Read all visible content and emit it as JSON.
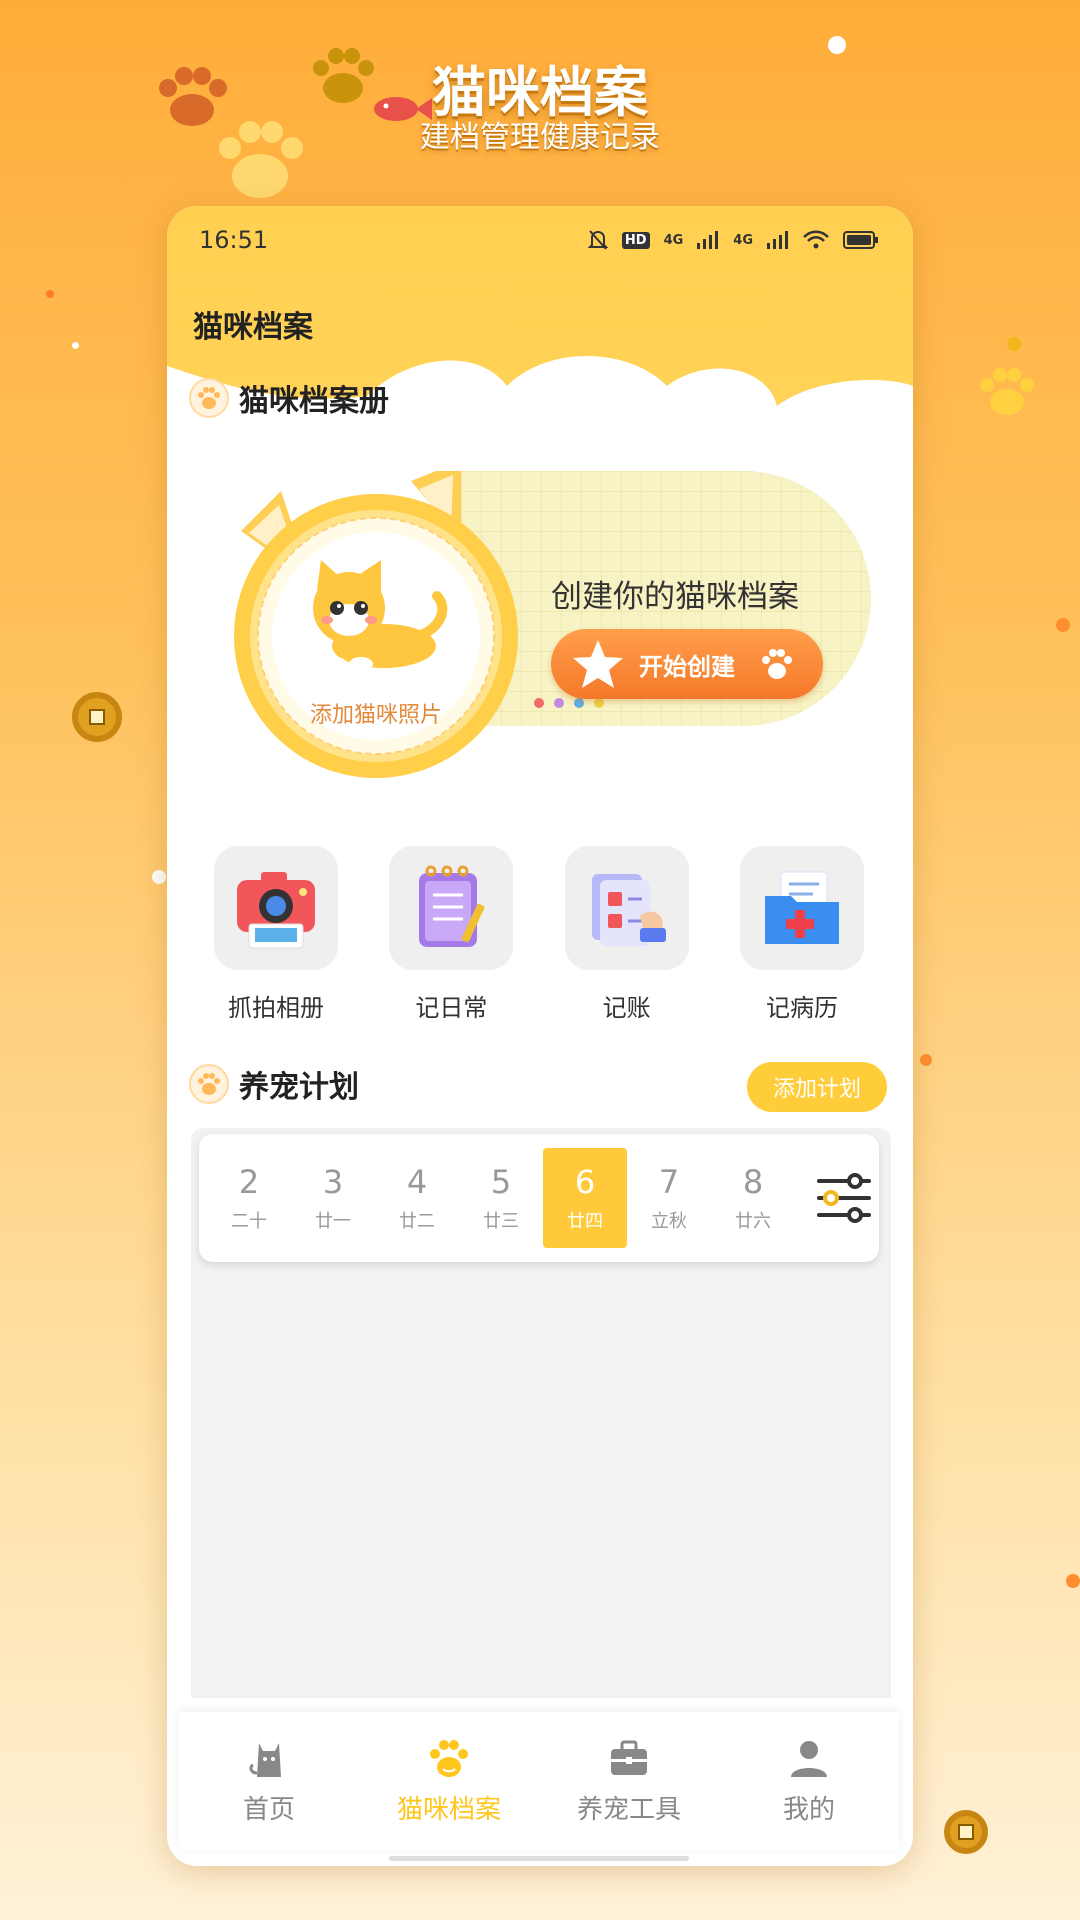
{
  "promo": {
    "title": "猫咪档案",
    "subtitle": "建档管理健康记录"
  },
  "statusbar": {
    "time": "16:51",
    "network_1": "4G",
    "network_2": "4G",
    "hd_label": "HD"
  },
  "app": {
    "title": "猫咪档案"
  },
  "archive": {
    "section_title": "猫咪档案册",
    "avatar_label": "添加猫咪照片",
    "create_text": "创建你的猫咪档案",
    "start_button": "开始创建"
  },
  "tools": [
    {
      "label": "抓拍相册",
      "icon": "camera-icon"
    },
    {
      "label": "记日常",
      "icon": "notebook-icon"
    },
    {
      "label": "记账",
      "icon": "ledger-icon"
    },
    {
      "label": "记病历",
      "icon": "medical-folder-icon"
    }
  ],
  "plan": {
    "section_title": "养宠计划",
    "add_button": "添加计划",
    "dates": [
      {
        "num": "2",
        "lunar": "二十"
      },
      {
        "num": "3",
        "lunar": "廿一"
      },
      {
        "num": "4",
        "lunar": "廿二"
      },
      {
        "num": "5",
        "lunar": "廿三"
      },
      {
        "num": "6",
        "lunar": "廿四"
      },
      {
        "num": "7",
        "lunar": "立秋"
      },
      {
        "num": "8",
        "lunar": "廿六"
      }
    ],
    "selected_index": 4
  },
  "nav": [
    {
      "label": "首页",
      "icon": "cat-icon"
    },
    {
      "label": "猫咪档案",
      "icon": "paw-icon"
    },
    {
      "label": "养宠工具",
      "icon": "toolbox-icon"
    },
    {
      "label": "我的",
      "icon": "user-icon"
    }
  ],
  "colors": {
    "accent": "#ffc61e",
    "button_orange": "#f5782a",
    "header_yellow": "#ffd150"
  }
}
